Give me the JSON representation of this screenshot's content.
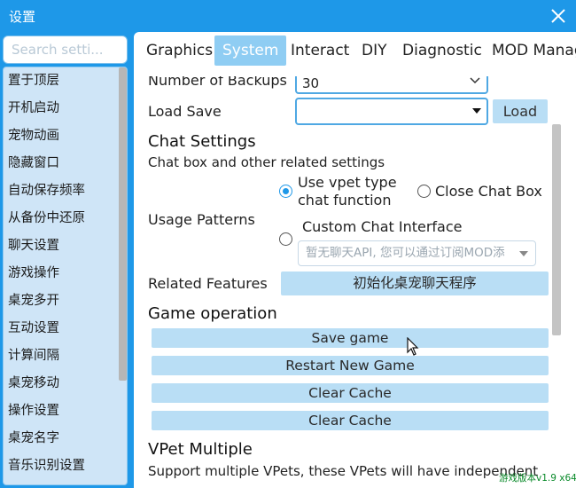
{
  "window": {
    "title": "设置",
    "accent_color": "#1e98e8",
    "close_icon": "close-icon"
  },
  "search": {
    "placeholder": "Search setti..."
  },
  "sidebar": {
    "items": [
      {
        "label": "置于顶层"
      },
      {
        "label": "开机启动"
      },
      {
        "label": "宠物动画"
      },
      {
        "label": "隐藏窗口"
      },
      {
        "label": "自动保存频率"
      },
      {
        "label": "从备份中还原"
      },
      {
        "label": "聊天设置"
      },
      {
        "label": "游戏操作"
      },
      {
        "label": "桌宠多开"
      },
      {
        "label": "互动设置"
      },
      {
        "label": "计算间隔"
      },
      {
        "label": "桌宠移动"
      },
      {
        "label": "操作设置"
      },
      {
        "label": "桌宠名字"
      },
      {
        "label": "音乐识别设置"
      }
    ]
  },
  "tabs": [
    {
      "label": "Graphics",
      "active": false
    },
    {
      "label": "System",
      "active": true
    },
    {
      "label": "Interact",
      "active": false
    },
    {
      "label": "DIY",
      "active": false
    },
    {
      "label": "Diagnostic",
      "active": false
    },
    {
      "label": "MOD Manag",
      "active": false
    }
  ],
  "system": {
    "backups": {
      "label": "Number of Backups",
      "value": "30",
      "icon": "chevron-down-icon"
    },
    "load_save": {
      "label": "Load Save",
      "value": "",
      "icon": "dropdown-arrow-icon",
      "button_label": "Load"
    },
    "chat": {
      "title": "Chat Settings",
      "description": "Chat box and other related settings",
      "usage_label": "Usage Patterns",
      "option_vpet": "Use vpet type chat function",
      "option_vpet_line1": "Use vpet type",
      "option_vpet_line2": "chat function",
      "option_close": "Close Chat Box",
      "option_custom": "Custom Chat Interface",
      "custom_select_value": "暂无聊天API, 您可以通过订阅MOD添",
      "related_label": "Related Features",
      "related_button": "初始化桌宠聊天程序",
      "selected_option": "option_vpet"
    },
    "game": {
      "title": "Game operation",
      "buttons": [
        {
          "label": "Save game"
        },
        {
          "label": "Restart New Game"
        },
        {
          "label": "Clear Cache"
        },
        {
          "label": "Clear Cache"
        }
      ]
    },
    "multi": {
      "title": "VPet Multiple",
      "description": "Support multiple VPets, these VPets will have independent"
    }
  },
  "version": "游戏版本v1.9 x64"
}
